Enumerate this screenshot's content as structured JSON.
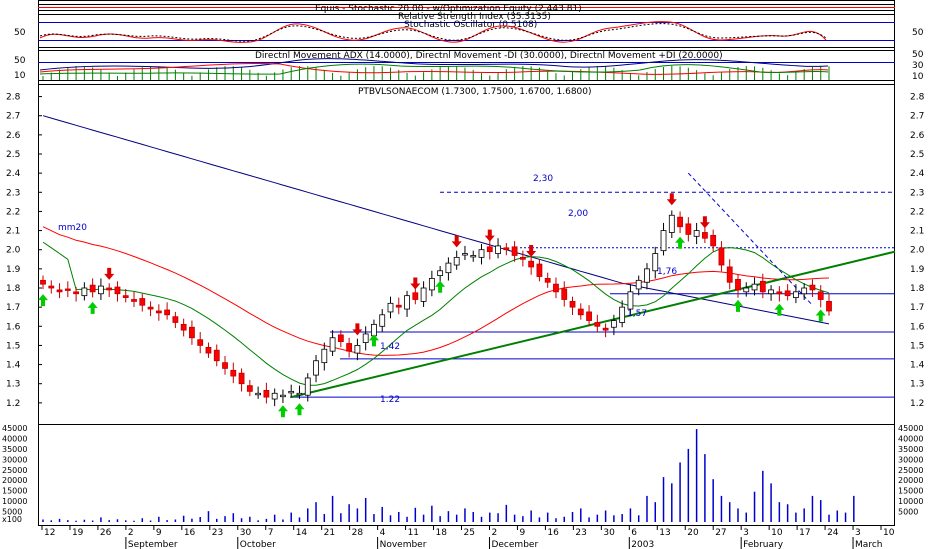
{
  "colors": {
    "frame": "#000000",
    "grid": "#b0b0b0",
    "trendline": "#008000",
    "ma_blue": "#000080",
    "ma_red": "#ff0000",
    "ma_green": "#008000",
    "level_blue": "#0000cc",
    "candle_up": "#ffffff",
    "candle_down": "#ff0000",
    "arrow_buy": "#00cc00",
    "arrow_sell": "#dd0000",
    "volume": "#0000cc"
  },
  "panels": {
    "equity_title": "Equis - Stochastic 20.00 - w/Optimization Equity (2,443.81)",
    "rsi_title": "Relative Strength Index (35.3135)",
    "stoch_title": "Stochastic Oscillator (0.5108)",
    "dmi_title": "Directnl Movement ADX (14.0000), Directnl Movement -DI (30.0000), Directnl Movement +DI (20.0000)",
    "price_title": "PTBVLSONAECOM (1.7300, 1.7500, 1.6700, 1.6800)",
    "stoch_axis": [
      "50",
      "50"
    ],
    "dmi_axis_left": [
      "50",
      "10"
    ],
    "dmi_axis_right": [
      "50",
      "30",
      "10"
    ],
    "volume_unit": "x100"
  },
  "annotations": {
    "mm20": "mm20",
    "lvl_230": "2,30",
    "lvl_200": "2,00",
    "lvl_176": "1,76",
    "lvl_157": "1,57",
    "lvl_142": "1,42",
    "lvl_122": "1.22"
  },
  "x_axis": {
    "day_ticks": [
      "12",
      "19",
      "26",
      "2",
      "9",
      "16",
      "23",
      "30",
      "7",
      "14",
      "21",
      "28",
      "4",
      "11",
      "18",
      "25",
      "2",
      "9",
      "16",
      "23",
      "30",
      "6",
      "13",
      "20",
      "27",
      "3",
      "10",
      "17",
      "24",
      "3",
      "10"
    ],
    "months": [
      "September",
      "October",
      "November",
      "December",
      "2003",
      "February",
      "March"
    ]
  },
  "chart_data": [
    {
      "type": "candlestick",
      "title": "PTBVLSONAECOM (1.7300, 1.7500, 1.6700, 1.6800)",
      "ylim": [
        1.1,
        2.85
      ],
      "y_ticks": [
        1.2,
        1.3,
        1.4,
        1.5,
        1.6,
        1.7,
        1.8,
        1.9,
        2.0,
        2.1,
        2.2,
        2.3,
        2.4,
        2.5,
        2.6,
        2.7,
        2.8
      ],
      "close": [
        1.82,
        1.8,
        1.78,
        1.79,
        1.77,
        1.8,
        1.78,
        1.81,
        1.79,
        1.77,
        1.75,
        1.73,
        1.71,
        1.69,
        1.67,
        1.66,
        1.62,
        1.58,
        1.54,
        1.5,
        1.46,
        1.42,
        1.38,
        1.34,
        1.3,
        1.26,
        1.25,
        1.23,
        1.25,
        1.24,
        1.26,
        1.25,
        1.33,
        1.42,
        1.48,
        1.54,
        1.52,
        1.47,
        1.5,
        1.56,
        1.61,
        1.66,
        1.72,
        1.7,
        1.76,
        1.74,
        1.8,
        1.85,
        1.89,
        1.93,
        1.96,
        1.98,
        1.97,
        2.0,
        1.99,
        2.02,
        2.0,
        1.97,
        1.95,
        1.91,
        1.86,
        1.83,
        1.78,
        1.74,
        1.7,
        1.66,
        1.63,
        1.6,
        1.58,
        1.63,
        1.7,
        1.78,
        1.84,
        1.9,
        1.98,
        2.1,
        2.18,
        2.12,
        2.08,
        2.1,
        2.06,
        2.02,
        1.92,
        1.83,
        1.79,
        1.8,
        1.82,
        1.78,
        1.79,
        1.77,
        1.76,
        1.78,
        1.8,
        1.79,
        1.74,
        1.68
      ],
      "overlays": [
        {
          "label": "mm20",
          "values": "moving average 20"
        },
        {
          "label": "",
          "values": "moving average 50"
        },
        {
          "label": "",
          "values": "moving average 200"
        }
      ],
      "horizontal_levels": [
        {
          "label": "2,30",
          "value": 2.3,
          "style": "dashed"
        },
        {
          "label": "2,00",
          "value": 2.01,
          "style": "dotted"
        },
        {
          "label": "1,76",
          "value": 1.77,
          "style": "solid"
        },
        {
          "label": "1,57",
          "value": 1.57,
          "style": "solid"
        },
        {
          "label": "1,42",
          "value": 1.43,
          "style": "solid"
        },
        {
          "label": "1.22",
          "value": 1.23,
          "style": "solid"
        }
      ],
      "trendline": {
        "from": [
          30,
          1.23
        ],
        "to": [
          103,
          1.99
        ]
      },
      "dashed_downtrend": {
        "from": [
          78,
          2.4
        ],
        "to": [
          93,
          1.71
        ]
      },
      "buy_arrows": [
        0,
        6,
        29,
        31,
        40,
        48,
        77,
        84,
        89,
        94
      ],
      "sell_arrows": [
        8,
        38,
        45,
        50,
        54,
        59,
        76,
        80,
        96
      ]
    },
    {
      "type": "bar",
      "title": "Volume",
      "ylabel": "x100",
      "ylim": [
        0,
        45000
      ],
      "y_ticks": [
        5000,
        10000,
        15000,
        20000,
        25000,
        30000,
        35000,
        40000,
        45000
      ],
      "values": [
        1200,
        800,
        1500,
        900,
        600,
        1100,
        700,
        2200,
        900,
        1300,
        800,
        600,
        1800,
        700,
        2500,
        900,
        1200,
        3000,
        1600,
        2400,
        5200,
        1500,
        2800,
        4200,
        1800,
        2500,
        800,
        1500,
        3500,
        1200,
        4500,
        2200,
        6500,
        9500,
        3800,
        12500,
        4200,
        8500,
        6500,
        11500,
        3800,
        7200,
        3200,
        4800,
        2500,
        6800,
        3500,
        7800,
        2800,
        5200,
        3500,
        6500,
        4800,
        2500,
        4500,
        4200,
        8200,
        3500,
        2800,
        5500,
        2200,
        4500,
        1800,
        2500,
        4800,
        6500,
        2200,
        3500,
        5500,
        3200,
        3800,
        6500,
        3200,
        12500,
        9500,
        21500,
        18500,
        28500,
        35000,
        44500,
        32500,
        20500,
        12500,
        9500,
        6500,
        4500,
        14500,
        24500,
        18500,
        9500,
        8500,
        4500,
        6500,
        12500,
        10500,
        3500,
        5500,
        4500,
        12500
      ]
    },
    {
      "type": "line",
      "title": "Relative Strength Index (35.3135) / Stochastic Oscillator (0.5108)",
      "ylim": [
        0,
        100
      ],
      "y_ticks": [
        50
      ]
    },
    {
      "type": "line",
      "title": "Directnl Movement ADX (14.0000), Directnl Movement -DI (30.0000), Directnl Movement +DI (20.0000)",
      "ylim": [
        0,
        60
      ],
      "y_ticks": [
        10,
        30,
        50
      ]
    }
  ]
}
